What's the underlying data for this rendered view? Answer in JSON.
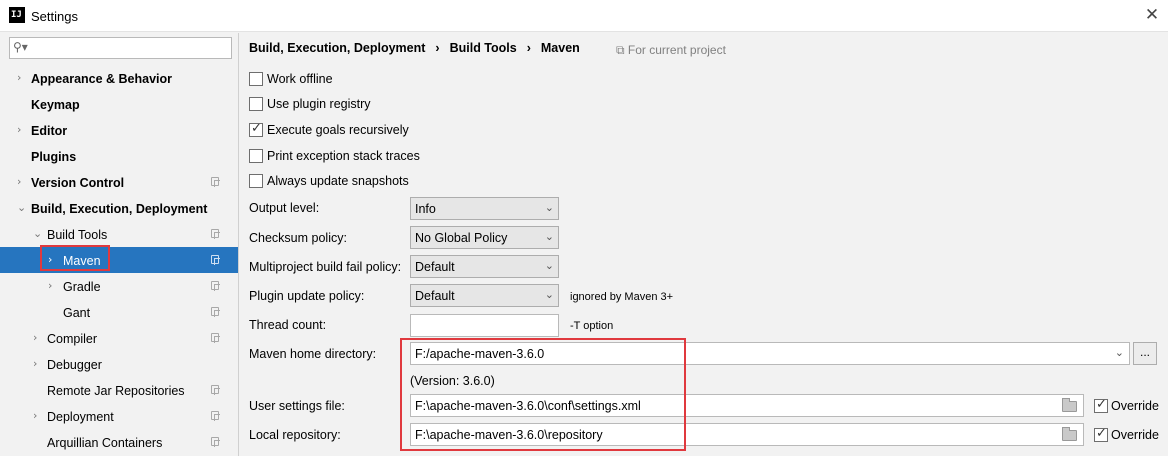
{
  "window": {
    "title": "Settings",
    "app_icon": "intellij-icon",
    "close_glyph": "✕"
  },
  "sidebar": {
    "search_placeholder": "",
    "items": [
      {
        "label": "Appearance & Behavior",
        "arrow": "›",
        "bold": true,
        "level": 0,
        "project": false
      },
      {
        "label": "Keymap",
        "arrow": "",
        "bold": true,
        "level": 0,
        "project": false
      },
      {
        "label": "Editor",
        "arrow": "›",
        "bold": true,
        "level": 0,
        "project": false
      },
      {
        "label": "Plugins",
        "arrow": "",
        "bold": true,
        "level": 0,
        "project": false
      },
      {
        "label": "Version Control",
        "arrow": "›",
        "bold": true,
        "level": 0,
        "project": true
      },
      {
        "label": "Build, Execution, Deployment",
        "arrow": "⌄",
        "bold": true,
        "level": 0,
        "project": false
      },
      {
        "label": "Build Tools",
        "arrow": "⌄",
        "bold": false,
        "level": 1,
        "project": true
      },
      {
        "label": "Maven",
        "arrow": "›",
        "bold": false,
        "level": 2,
        "project": true,
        "selected": true
      },
      {
        "label": "Gradle",
        "arrow": "›",
        "bold": false,
        "level": 2,
        "project": true
      },
      {
        "label": "Gant",
        "arrow": "",
        "bold": false,
        "level": 2,
        "project": true
      },
      {
        "label": "Compiler",
        "arrow": "›",
        "bold": false,
        "level": 1,
        "project": true
      },
      {
        "label": "Debugger",
        "arrow": "›",
        "bold": false,
        "level": 1,
        "project": false
      },
      {
        "label": "Remote Jar Repositories",
        "arrow": "",
        "bold": false,
        "level": 1,
        "project": true
      },
      {
        "label": "Deployment",
        "arrow": "›",
        "bold": false,
        "level": 1,
        "project": true
      },
      {
        "label": "Arquillian Containers",
        "arrow": "",
        "bold": false,
        "level": 1,
        "project": true
      }
    ]
  },
  "breadcrumb": {
    "part1": "Build, Execution, Deployment",
    "part2": "Build Tools",
    "part3": "Maven",
    "separator": "›"
  },
  "scope_note": "For current project",
  "checkboxes": {
    "work_offline": {
      "label": "Work offline",
      "checked": false
    },
    "use_plugin_registry": {
      "label": "Use plugin registry",
      "checked": false
    },
    "execute_goals_recursively": {
      "label": "Execute goals recursively",
      "checked": true
    },
    "print_exception_stack_traces": {
      "label": "Print exception stack traces",
      "checked": false
    },
    "always_update_snapshots": {
      "label": "Always update snapshots",
      "checked": false
    }
  },
  "fields": {
    "output_level": {
      "label": "Output level:",
      "value": "Info"
    },
    "checksum_policy": {
      "label": "Checksum policy:",
      "value": "No Global Policy"
    },
    "multiproject_fail_policy": {
      "label": "Multiproject build fail policy:",
      "value": "Default"
    },
    "plugin_update_policy": {
      "label": "Plugin update policy:",
      "value": "Default",
      "hint": "ignored by Maven 3+"
    },
    "thread_count": {
      "label": "Thread count:",
      "value": "",
      "hint": "-T option"
    },
    "maven_home": {
      "label": "Maven home directory:",
      "value": "F:/apache-maven-3.6.0",
      "version": "(Version: 3.6.0)",
      "browse_label": "..."
    },
    "user_settings": {
      "label": "User settings file:",
      "value": "F:\\apache-maven-3.6.0\\conf\\settings.xml",
      "override_label": "Override",
      "override_checked": true
    },
    "local_repository": {
      "label": "Local repository:",
      "value": "F:\\apache-maven-3.6.0\\repository",
      "override_label": "Override",
      "override_checked": true
    }
  },
  "colors": {
    "selection": "#2675bf",
    "highlight_box": "#e0393e",
    "panel_bg": "#f2f2f2"
  }
}
